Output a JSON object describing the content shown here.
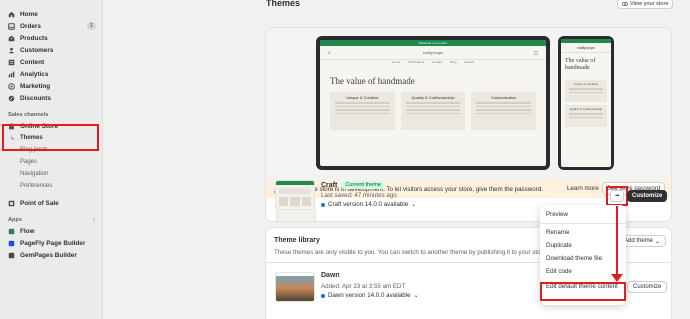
{
  "sidebar": {
    "items": [
      {
        "label": "Home",
        "icon": "home-icon"
      },
      {
        "label": "Orders",
        "icon": "orders-icon",
        "badge": "1"
      },
      {
        "label": "Products",
        "icon": "products-icon"
      },
      {
        "label": "Customers",
        "icon": "customers-icon"
      },
      {
        "label": "Content",
        "icon": "content-icon"
      },
      {
        "label": "Analytics",
        "icon": "analytics-icon"
      },
      {
        "label": "Marketing",
        "icon": "marketing-icon"
      },
      {
        "label": "Discounts",
        "icon": "discounts-icon"
      }
    ],
    "sales_channels_label": "Sales channels",
    "online_store": "Online Store",
    "sub_items": [
      "Themes",
      "Blog posts",
      "Pages",
      "Navigation",
      "Preferences"
    ],
    "point_of_sale": "Point of Sale",
    "apps_label": "Apps",
    "apps": [
      "Flow",
      "PageFly Page Builder",
      "GemPages Builder"
    ]
  },
  "header": {
    "title": "Themes",
    "view_store": "View your store"
  },
  "preview": {
    "announcement": "Welcome to our store",
    "brand": "crafty.loops",
    "links": [
      "Home",
      "All Products",
      "Contact",
      "Blog",
      "Search"
    ],
    "hero": "The value of handmade",
    "columns": [
      {
        "title": "Unique & Creative"
      },
      {
        "title": "Quality & Craftsmanship"
      },
      {
        "title": "Customization"
      }
    ],
    "mobile_cards": [
      "Unique & Creative",
      "Quality & Craftsmanship"
    ]
  },
  "banner": {
    "message": "Your online store is in development. To let visitors access your store, give them the password.",
    "learn_more": "Learn more",
    "password_button": "See store password"
  },
  "current_theme": {
    "name": "Craft",
    "badge": "Current theme",
    "saved": "Last saved: 47 minutes ago",
    "version": "Craft version 14.0.0 available",
    "more": "•••",
    "customize": "Customize"
  },
  "library": {
    "title": "Theme library",
    "description": "These themes are only visible to you. You can switch to another theme by publishing it to your store.",
    "add_theme": "Add theme",
    "theme": {
      "name": "Dawn",
      "added": "Added: Apr 23 at 3:55 am EDT",
      "version": "Dawn version 14.0.0 available",
      "customize": "Customize"
    }
  },
  "dropdown": {
    "items": [
      "Preview",
      "Rename",
      "Duplicate",
      "Download theme file",
      "Edit code",
      "Edit default theme content"
    ]
  },
  "colors": {
    "highlight": "#e11d1d",
    "banner_bg": "#fff1dd",
    "badge_bg": "#cdfee1",
    "dark_button": "#303030"
  }
}
